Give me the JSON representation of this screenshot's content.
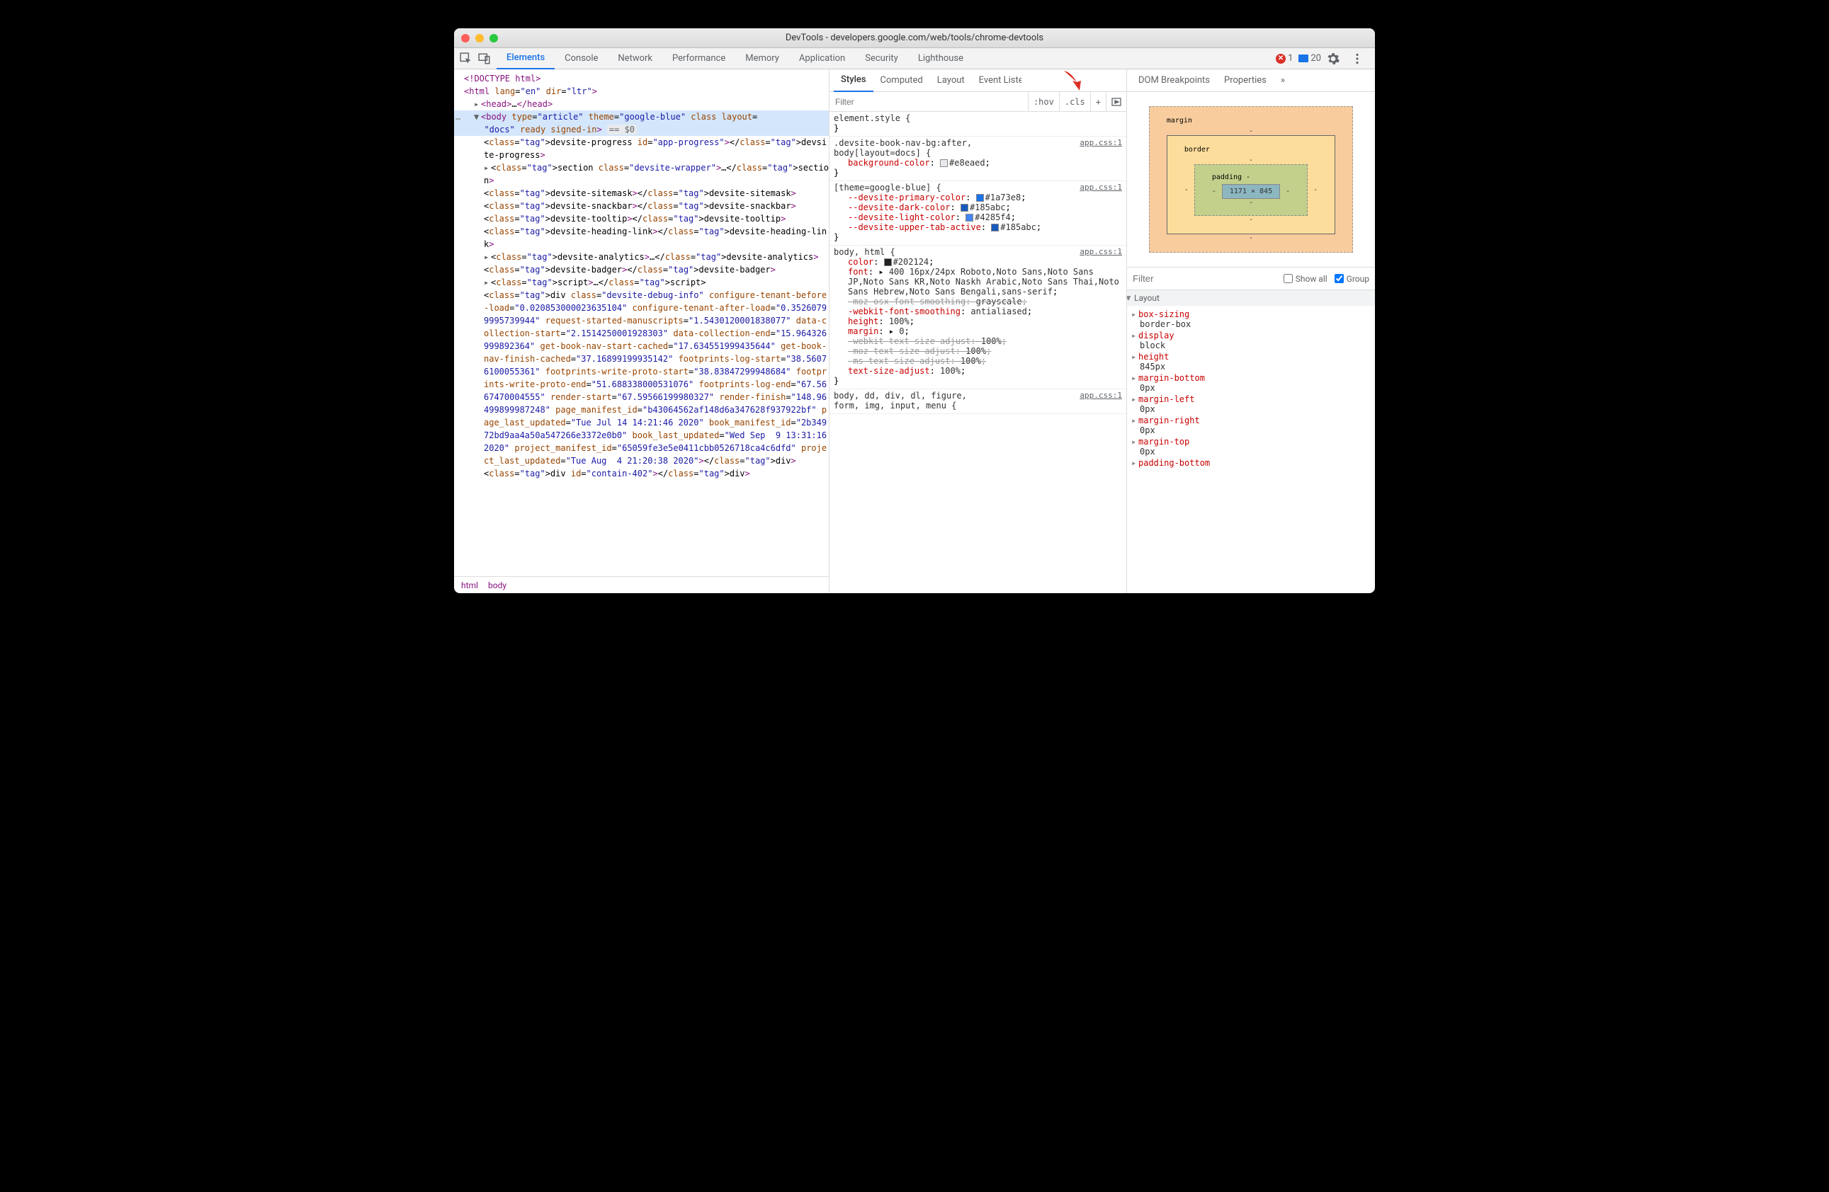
{
  "window": {
    "title": "DevTools - developers.google.com/web/tools/chrome-devtools"
  },
  "toolbar": {
    "tabs": [
      "Elements",
      "Console",
      "Network",
      "Performance",
      "Memory",
      "Application",
      "Security",
      "Lighthouse"
    ],
    "active_tab": "Elements",
    "errors": "1",
    "messages": "20"
  },
  "dom": {
    "doctype": "<!DOCTYPE html>",
    "html_open": {
      "pre": "<html ",
      "a1n": "lang",
      "a1v": "en",
      "a2n": "dir",
      "a2v": "ltr",
      "suf": ">"
    },
    "head": "<head>…</head>",
    "body_open": {
      "pre": "<body ",
      "a1n": "type",
      "a1v": "article",
      "a2n": "theme",
      "a2v": "google-blue",
      "a3n": "class",
      "a4n": "layout",
      "suf": "="
    },
    "body_cont": {
      "a4v": "docs",
      "a5n": "ready",
      "a6n": "signed-in",
      "eq": "== $0"
    },
    "progress": "<devsite-progress id=\"app-progress\"></devsite-progress>",
    "section": "<section class=\"devsite-wrapper\">…</section>",
    "sitemask": "<devsite-sitemask></devsite-sitemask>",
    "snackbar": "<devsite-snackbar></devsite-snackbar>",
    "tooltip": "<devsite-tooltip></devsite-tooltip>",
    "heading": "<devsite-heading-link></devsite-heading-link>",
    "analytics": "<devsite-analytics>…</devsite-analytics>",
    "badger": "<devsite-badger></devsite-badger>",
    "script": "<script>…</scr",
    "debug_div_open": "<div class=\"devsite-debug-info\" configure-tenant-before-load=\"0.020853000023635104\" configure-tenant-after-load=\"0.35260799995739944\" request-started-manuscripts=\"1.5430120001838077\" data-collection-start=\"2.1514250001928303\" data-collection-end=\"15.964326999892364\" get-book-nav-start-cached=\"17.634551999435644\" get-book-nav-finish-cached=\"37.16899199935142\" footprints-log-start=\"38.56076100055361\" footprints-write-proto-start=\"38.83847299948684\" footprints-write-proto-end=\"51.688338000531076\" footprints-log-end=\"67.5667470004555\" render-start=\"67.59566199980327\" render-finish=\"148.96499899987248\" page_manifest_id=\"b43064562af148d6a347628f937922bf\" page_last_updated=\"Tue Jul 14 14:21:46 2020\" book_manifest_id=\"2b34972bd9aa4a50a547266e3372e0b0\" book_last_updated=\"Wed Sep  9 13:31:16 2020\" project_manifest_id=\"65059fe3e5e0411cbb0526718ca4c6dfd\" project_last_updated=\"Tue Aug  4 21:20:38 2020\"></div>",
    "contain": "<div id=\"contain-402\"></div>"
  },
  "breadcrumbs": [
    "html",
    "body"
  ],
  "subtabs_mid": [
    "Styles",
    "Computed",
    "Layout",
    "Event Listeners"
  ],
  "subtabs_right": [
    "DOM Breakpoints",
    "Properties"
  ],
  "styles_toolbar": {
    "filter_placeholder": "Filter",
    "hov": ":hov",
    "cls": ".cls",
    "plus": "+"
  },
  "style_rules": [
    {
      "selector": "element.style {",
      "lines": [],
      "close": "}"
    },
    {
      "selector": ".devsite-book-nav-bg:after,\nbody[layout=docs] {",
      "source": "app.css:1",
      "lines": [
        {
          "n": "background-color",
          "v": "#e8eaed",
          "swatch": "#e8eaed"
        }
      ],
      "close": "}"
    },
    {
      "selector": "[theme=google-blue] {",
      "source": "app.css:1",
      "lines": [
        {
          "n": "--devsite-primary-color",
          "v": "#1a73e8",
          "swatch": "#1a73e8",
          "custom": true
        },
        {
          "n": "--devsite-dark-color",
          "v": "#185abc",
          "swatch": "#185abc",
          "custom": true
        },
        {
          "n": "--devsite-light-color",
          "v": "#4285f4",
          "swatch": "#4285f4",
          "custom": true
        },
        {
          "n": "--devsite-upper-tab-active",
          "v": "#185abc",
          "swatch": "#185abc",
          "custom": true
        }
      ],
      "close": "}"
    },
    {
      "selector": "body, html {",
      "source": "app.css:1",
      "lines": [
        {
          "n": "color",
          "v": "#202124",
          "swatch": "#202124"
        },
        {
          "n": "font",
          "v": "400 16px/24px Roboto,Noto Sans,Noto Sans JP,Noto Sans KR,Noto Naskh Arabic,Noto Sans Thai,Noto Sans Hebrew,Noto Sans Bengali,sans-serif",
          "expand": true
        },
        {
          "n": "-moz-osx-font-smoothing",
          "v": "grayscale",
          "struck": true
        },
        {
          "n": "-webkit-font-smoothing",
          "v": "antialiased"
        },
        {
          "n": "height",
          "v": "100%"
        },
        {
          "n": "margin",
          "v": "0",
          "expand": true
        },
        {
          "n": "-webkit-text-size-adjust",
          "v": "100%",
          "struck": true
        },
        {
          "n": "-moz-text-size-adjust",
          "v": "100%",
          "struck": true
        },
        {
          "n": "-ms-text-size-adjust",
          "v": "100%",
          "struck": true
        },
        {
          "n": "text-size-adjust",
          "v": "100%"
        }
      ],
      "close": "}"
    },
    {
      "selector": "body, dd, div, dl, figure,\nform, img, input, menu {",
      "source": "app.css:1",
      "lines": [],
      "close": ""
    }
  ],
  "box_model": {
    "margin": "margin",
    "border": "border",
    "padding": "padding",
    "content": "1171 × 845"
  },
  "computed_filter": {
    "placeholder": "Filter",
    "show_all": "Show all",
    "group": "Group"
  },
  "layout_header": "Layout",
  "computed_props": [
    {
      "n": "box-sizing",
      "v": "border-box"
    },
    {
      "n": "display",
      "v": "block"
    },
    {
      "n": "height",
      "v": "845px"
    },
    {
      "n": "margin-bottom",
      "v": "0px"
    },
    {
      "n": "margin-left",
      "v": "0px"
    },
    {
      "n": "margin-right",
      "v": "0px"
    },
    {
      "n": "margin-top",
      "v": "0px"
    },
    {
      "n": "padding-bottom",
      "v": ""
    }
  ]
}
